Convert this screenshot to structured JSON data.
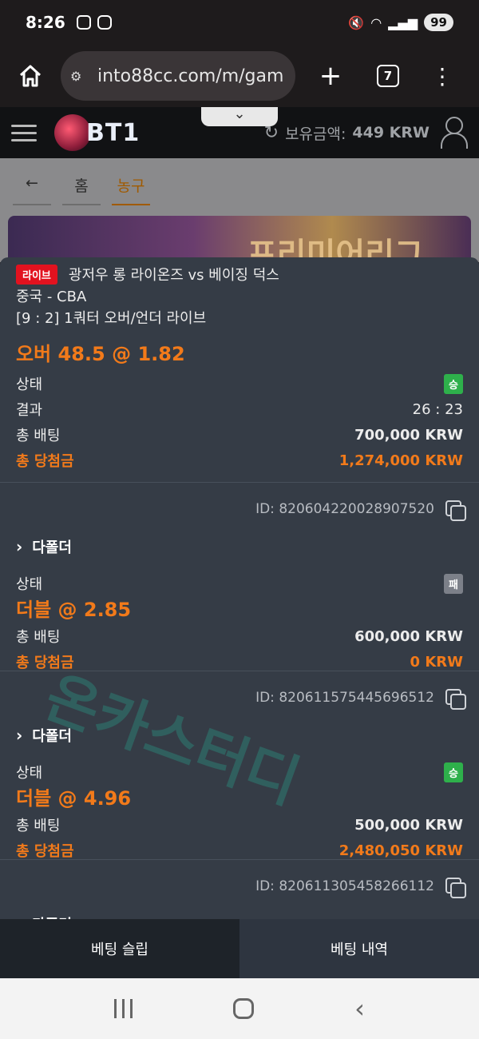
{
  "status_bar": {
    "time": "8:26",
    "battery": "99"
  },
  "browser": {
    "url": "into88cc.com/m/gam",
    "tab_count": "7"
  },
  "header": {
    "logo_text": "BT1",
    "balance_label": "보유금액:",
    "balance_value": "449 KRW"
  },
  "breadcrumbs": [
    "←",
    "홈",
    "농구"
  ],
  "banner_text": "프리미어리그",
  "watermark": "온카스터디",
  "bets": [
    {
      "live_badge": "라이브",
      "match": "광저우 롱 라이온즈 vs 베이징 덕스",
      "league": "중국 - CBA",
      "market": "[9 : 2] 1쿼터 오버/언더 라이브",
      "pick": "오버 48.5 @ 1.82",
      "status_label": "상태",
      "status_badge": "승",
      "result_label": "결과",
      "result_value": "26 : 23",
      "stake_label": "총 배팅",
      "stake_value": "700,000 KRW",
      "win_label": "총 당첨금",
      "win_value": "1,274,000 KRW"
    },
    {
      "id": "ID: 820604220028907520",
      "type": "다폴더",
      "status_label": "상태",
      "status_badge": "패",
      "pick": "더블 @ 2.85",
      "stake_label": "총 배팅",
      "stake_value": "600,000 KRW",
      "win_label": "총 당첨금",
      "win_value": "0 KRW"
    },
    {
      "id": "ID: 820611575445696512",
      "type": "다폴더",
      "status_label": "상태",
      "status_badge": "승",
      "pick": "더블 @ 4.96",
      "stake_label": "총 배팅",
      "stake_value": "500,000 KRW",
      "win_label": "총 당첨금",
      "win_value": "2,480,050 KRW"
    },
    {
      "id": "ID: 820611305458266112",
      "type": "다폴더"
    }
  ],
  "bottom_tabs": [
    "베팅 슬립",
    "베팅 내역"
  ]
}
